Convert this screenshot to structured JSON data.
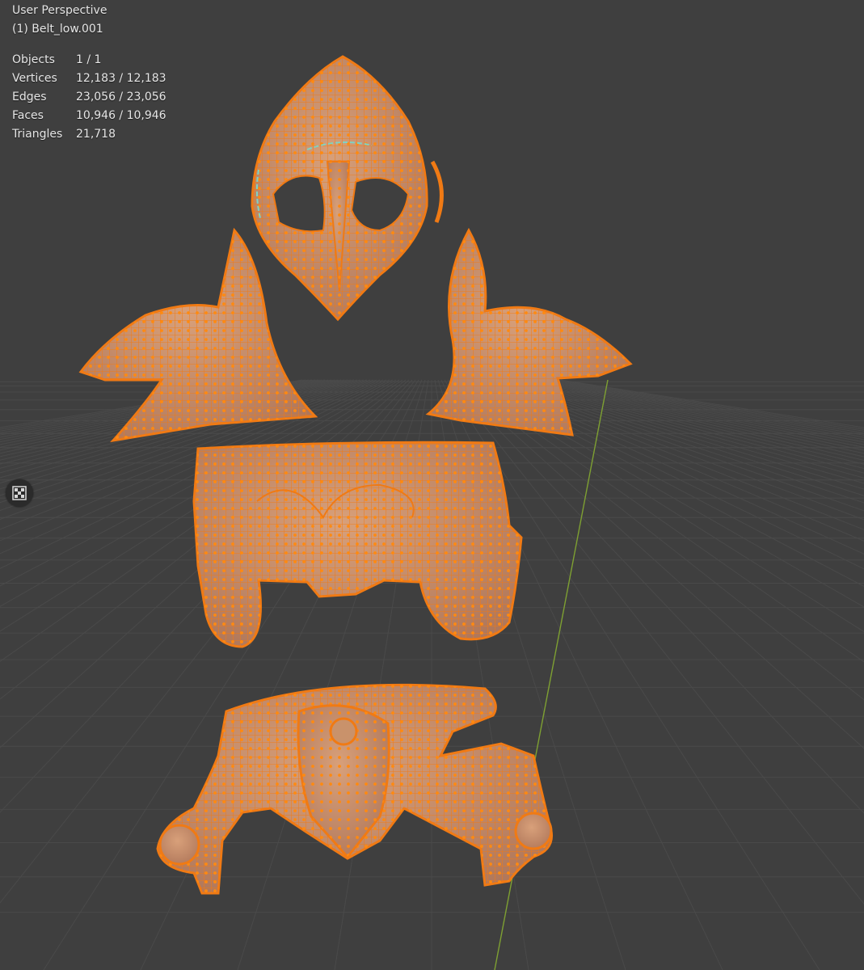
{
  "viewport": {
    "view_name": "User Perspective",
    "object_name": "(1) Belt_low.001"
  },
  "statistics": [
    {
      "label": "Objects",
      "value": "1 / 1"
    },
    {
      "label": "Vertices",
      "value": "12,183 / 12,183"
    },
    {
      "label": "Edges",
      "value": "23,056 / 23,056"
    },
    {
      "label": "Faces",
      "value": "10,946 / 10,946"
    },
    {
      "label": "Triangles",
      "value": "21,718"
    }
  ],
  "icons": {
    "left_gizmo": "checker-grid-icon"
  },
  "colors": {
    "background": "#3f3f3f",
    "grid": "#4a4a4a",
    "mesh_fill": "#c9926b",
    "wire": "#f07a14",
    "vertex": "#ff8a10",
    "seam": "#7fd3c4",
    "y_axis": "#7ea032"
  }
}
